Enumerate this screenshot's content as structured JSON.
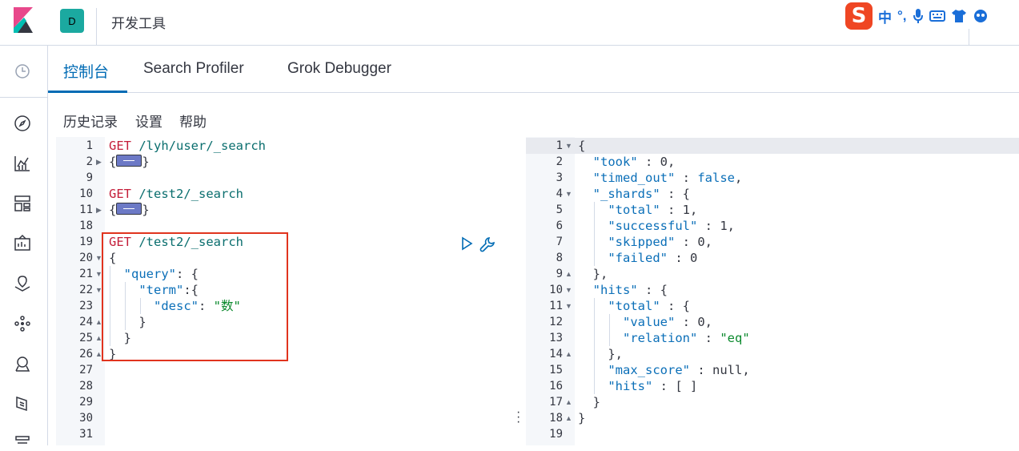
{
  "header": {
    "space_initial": "D",
    "title": "开发工具",
    "ime": {
      "mode": "中",
      "punct": "°,"
    }
  },
  "tabs": [
    {
      "label": "控制台",
      "active": true
    },
    {
      "label": "Search Profiler",
      "active": false
    },
    {
      "label": "Grok Debugger",
      "active": false
    }
  ],
  "subnav": {
    "history": "历史记录",
    "settings": "设置",
    "help": "帮助"
  },
  "request_lines": [
    {
      "n": "1"
    },
    {
      "n": "2"
    },
    {
      "n": "9"
    },
    {
      "n": "10"
    },
    {
      "n": "11"
    },
    {
      "n": "18"
    },
    {
      "n": "19"
    },
    {
      "n": "20"
    },
    {
      "n": "21"
    },
    {
      "n": "22"
    },
    {
      "n": "23"
    },
    {
      "n": "24"
    },
    {
      "n": "25"
    },
    {
      "n": "26"
    },
    {
      "n": "27"
    },
    {
      "n": "28"
    },
    {
      "n": "29"
    },
    {
      "n": "30"
    },
    {
      "n": "31"
    }
  ],
  "request": {
    "r1": {
      "method": "GET",
      "path": "/lyh/user/_search"
    },
    "r2": {
      "method": "GET",
      "path": "/test2/_search"
    },
    "r3": {
      "method": "GET",
      "path": "/test2/_search"
    },
    "query_key": "\"query\"",
    "term_key": "\"term\"",
    "desc_key": "\"desc\"",
    "desc_value": "\"数\""
  },
  "response_lines": [
    {
      "n": "1"
    },
    {
      "n": "2"
    },
    {
      "n": "3"
    },
    {
      "n": "4"
    },
    {
      "n": "5"
    },
    {
      "n": "6"
    },
    {
      "n": "7"
    },
    {
      "n": "8"
    },
    {
      "n": "9"
    },
    {
      "n": "10"
    },
    {
      "n": "11"
    },
    {
      "n": "12"
    },
    {
      "n": "13"
    },
    {
      "n": "14"
    },
    {
      "n": "15"
    },
    {
      "n": "16"
    },
    {
      "n": "17"
    },
    {
      "n": "18"
    },
    {
      "n": "19"
    }
  ],
  "response": {
    "took_key": "\"took\"",
    "took_val": "0",
    "timed_out_key": "\"timed_out\"",
    "timed_out_val": "false",
    "shards_key": "\"_shards\"",
    "total_key": "\"total\"",
    "total_val": "1",
    "successful_key": "\"successful\"",
    "successful_val": "1",
    "skipped_key": "\"skipped\"",
    "skipped_val": "0",
    "failed_key": "\"failed\"",
    "failed_val": "0",
    "hits_key": "\"hits\"",
    "hits_total_key": "\"total\"",
    "value_key": "\"value\"",
    "value_val": "0",
    "relation_key": "\"relation\"",
    "relation_val": "\"eq\"",
    "max_score_key": "\"max_score\"",
    "max_score_val": "null",
    "inner_hits_key": "\"hits\"",
    "inner_hits_val": "[ ]"
  },
  "colors": {
    "accent": "#006bb4",
    "highlight_border": "#e1341e",
    "space_badge": "#1ba9a0"
  }
}
